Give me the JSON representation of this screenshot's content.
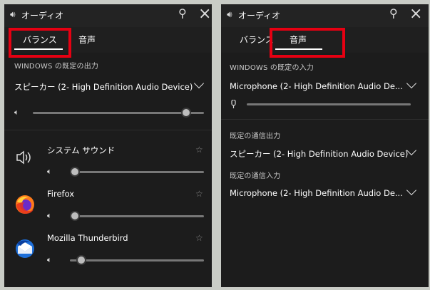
{
  "left": {
    "title": "オーディオ",
    "tabs": {
      "balance": "バランス",
      "voice": "音声"
    },
    "default_output_label": "WINDOWS の既定の出力",
    "output_device": "スピーカー (2- High Definition Audio Device)",
    "master_volume": 0.92,
    "apps": [
      {
        "name": "システム サウンド",
        "icon": "speaker-icon",
        "volume": 0.0
      },
      {
        "name": "Firefox",
        "icon": "firefox-icon",
        "volume": 0.0
      },
      {
        "name": "Mozilla Thunderbird",
        "icon": "thunderbird-icon",
        "volume": 0.05
      }
    ]
  },
  "right": {
    "title": "オーディオ",
    "tabs": {
      "balance": "バランス",
      "voice": "音声"
    },
    "default_input_label": "WINDOWS の既定の入力",
    "input_device": "Microphone (2- High Definition Audio De...",
    "comm_output_label": "既定の通信出力",
    "comm_output_device": "スピーカー (2- High Definition Audio Device)",
    "comm_input_label": "既定の通信入力",
    "comm_input_device": "Microphone (2- High Definition Audio De..."
  },
  "colors": {
    "panel_bg": "#1c1c1c",
    "highlight": "#e60012",
    "accent": "#ffffff"
  }
}
